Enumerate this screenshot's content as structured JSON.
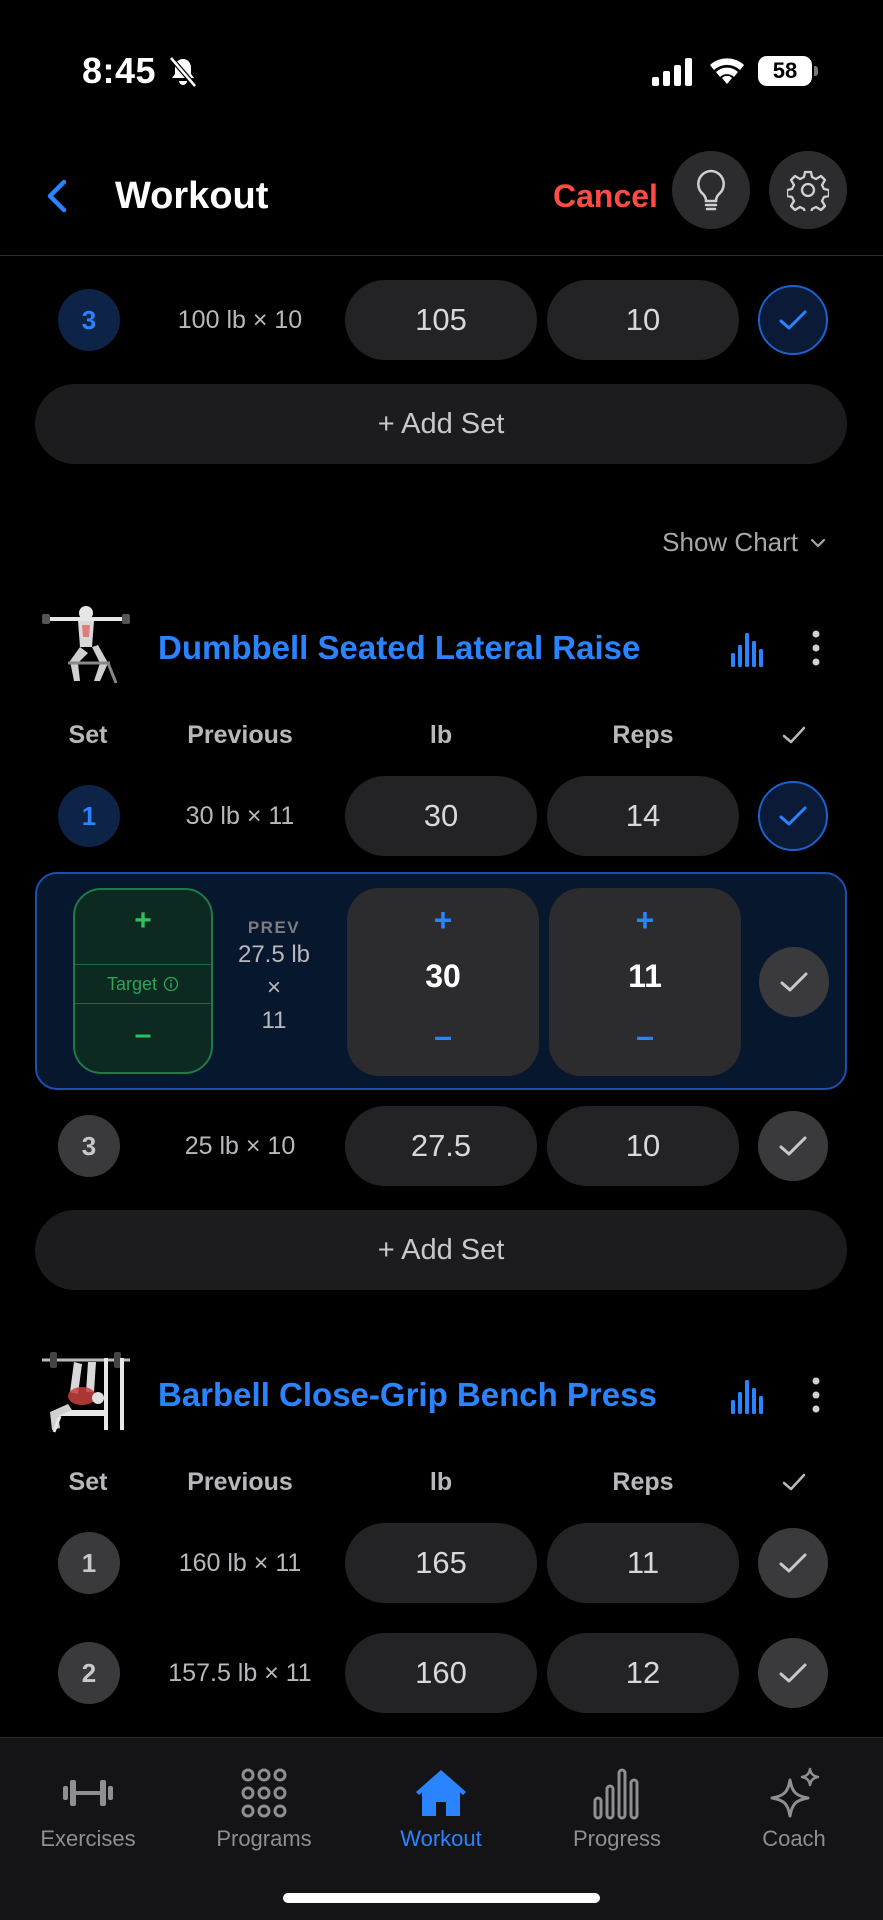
{
  "status_bar": {
    "time": "8:45",
    "battery": "58"
  },
  "header": {
    "title": "Workout",
    "cancel_label": "Cancel"
  },
  "colors": {
    "accent": "#2a84ff",
    "danger": "#ff4b43",
    "target_green": "#30c060"
  },
  "previous_exercise": {
    "rows": [
      {
        "set": "3",
        "previous": "100 lb × 10",
        "lb": "105",
        "reps": "10",
        "done": true
      }
    ],
    "add_set_label": "+ Add Set"
  },
  "show_chart_label": "Show Chart",
  "columns": {
    "set": "Set",
    "previous": "Previous",
    "lb": "lb",
    "reps": "Reps",
    "check": "✓"
  },
  "exercise1": {
    "name": "Dumbbell Seated Lateral Raise",
    "row1": {
      "set": "1",
      "previous": "30 lb × 11",
      "lb": "30",
      "reps": "14",
      "done": true
    },
    "active": {
      "target_label": "Target",
      "plus": "+",
      "minus": "–",
      "prev_caption": "PREV",
      "prev_weight": "27.5 lb",
      "prev_times": "×",
      "prev_reps": "11",
      "lb": "30",
      "reps": "11"
    },
    "row3": {
      "set": "3",
      "previous": "25 lb × 10",
      "lb": "27.5",
      "reps": "10",
      "done": false
    },
    "add_set_label": "+ Add Set"
  },
  "exercise2": {
    "name": "Barbell Close-Grip Bench Press",
    "row1": {
      "set": "1",
      "previous": "160 lb × 11",
      "lb": "165",
      "reps": "11",
      "done": false
    },
    "row2": {
      "set": "2",
      "previous": "157.5 lb × 11",
      "lb": "160",
      "reps": "12",
      "done": false
    }
  },
  "tabs": [
    {
      "label": "Exercises",
      "icon": "dumbbell-icon"
    },
    {
      "label": "Programs",
      "icon": "grid-dots-icon"
    },
    {
      "label": "Workout",
      "icon": "home-icon",
      "active": true
    },
    {
      "label": "Progress",
      "icon": "bar-chart-icon"
    },
    {
      "label": "Coach",
      "icon": "sparkles-icon"
    }
  ]
}
